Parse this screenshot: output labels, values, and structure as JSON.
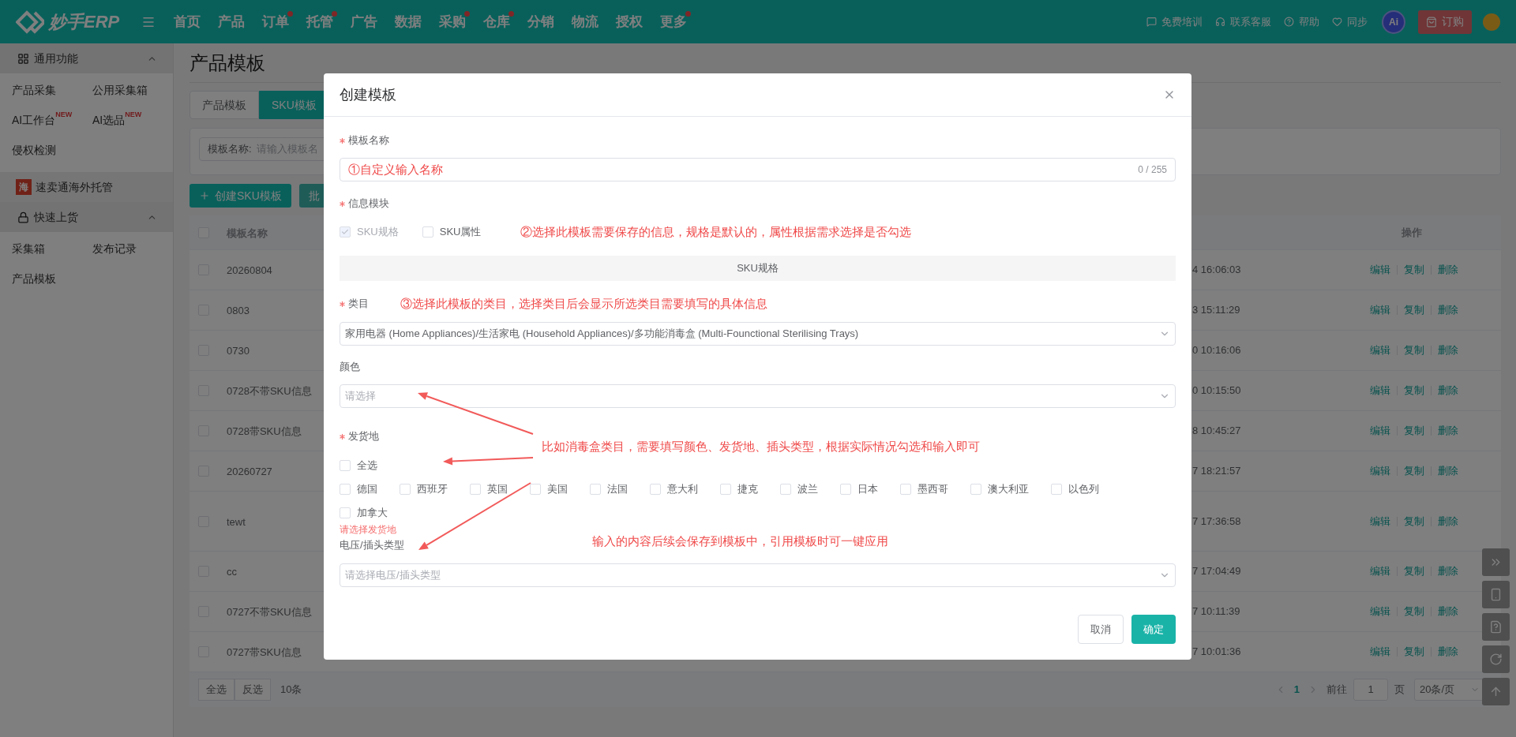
{
  "top_nav": {
    "logo": "妙手ERP",
    "items": [
      {
        "label": "首页",
        "badge": false
      },
      {
        "label": "产品",
        "badge": false
      },
      {
        "label": "订单",
        "badge": true
      },
      {
        "label": "托管",
        "badge": true
      },
      {
        "label": "广告",
        "badge": false
      },
      {
        "label": "数据",
        "badge": false
      },
      {
        "label": "采购",
        "badge": true
      },
      {
        "label": "仓库",
        "badge": true
      },
      {
        "label": "分销",
        "badge": false
      },
      {
        "label": "物流",
        "badge": false
      },
      {
        "label": "授权",
        "badge": false
      },
      {
        "label": "更多",
        "badge": true
      }
    ],
    "links": [
      {
        "label": "免费培训",
        "kind": "chat"
      },
      {
        "label": "联系客服",
        "kind": "service"
      },
      {
        "label": "帮助",
        "kind": "help"
      },
      {
        "label": "同步",
        "kind": "sync"
      }
    ],
    "ai_badge": "Ai",
    "order_button": "订购"
  },
  "sidebar": {
    "sections": [
      {
        "title": "通用功能",
        "kind": "grid",
        "expanded": true,
        "items": [
          {
            "label": "产品采集"
          },
          {
            "label": "公用采集箱"
          },
          {
            "label": "AI工作台",
            "tag": "NEW"
          },
          {
            "label": "AI选品",
            "tag": "NEW"
          },
          {
            "label": "侵权检测"
          }
        ]
      },
      {
        "title": "速卖通海外托管",
        "kind": "link",
        "icon_text": "海"
      },
      {
        "title": "快速上货",
        "kind": "lock",
        "expanded": true,
        "items": [
          {
            "label": "采集箱"
          },
          {
            "label": "发布记录"
          },
          {
            "label": "产品模板"
          }
        ]
      }
    ]
  },
  "page": {
    "title": "产品模板",
    "tabs": [
      {
        "label": "产品模板",
        "selected": false
      },
      {
        "label": "SKU模板",
        "selected": true
      }
    ],
    "filter": {
      "label": "模板名称:",
      "placeholder": "请输入模板名"
    },
    "actions": [
      {
        "label": "创建SKU模板",
        "kind": "primary"
      },
      {
        "label": "批",
        "kind": "disabled"
      }
    ],
    "table": {
      "all_checked": false,
      "columns": [
        "模板名称",
        "操作"
      ],
      "rows": [
        {
          "name": "20260804",
          "time": "4 16:06:03",
          "checked": false,
          "tall": false,
          "actions": [
            "编辑",
            "复制",
            "删除"
          ]
        },
        {
          "name": "0803",
          "time": "3 15:11:29",
          "checked": false,
          "tall": false,
          "actions": [
            "编辑",
            "复制",
            "删除"
          ]
        },
        {
          "name": "0730",
          "time": "0 10:16:06",
          "checked": false,
          "tall": false,
          "actions": [
            "编辑",
            "复制",
            "删除"
          ]
        },
        {
          "name": "0728不带SKU信息",
          "time": "0 10:15:50",
          "checked": false,
          "tall": false,
          "actions": [
            "编辑",
            "复制",
            "删除"
          ]
        },
        {
          "name": "0728带SKU信息",
          "time": "8 10:45:27",
          "checked": false,
          "tall": false,
          "actions": [
            "编辑",
            "复制",
            "删除"
          ]
        },
        {
          "name": "20260727",
          "time": "7 18:21:57",
          "checked": false,
          "tall": false,
          "actions": [
            "编辑",
            "复制",
            "删除"
          ]
        },
        {
          "name": "tewt",
          "time": "7 17:36:58",
          "checked": false,
          "tall": true,
          "actions": [
            "编辑",
            "复制",
            "删除"
          ]
        },
        {
          "name": "cc",
          "time": "7 17:04:49",
          "checked": false,
          "tall": false,
          "actions": [
            "编辑",
            "复制",
            "删除"
          ]
        },
        {
          "name": "0727不带SKU信息",
          "time": "7 10:11:39",
          "checked": false,
          "tall": false,
          "actions": [
            "编辑",
            "复制",
            "删除"
          ]
        },
        {
          "name": "0727带SKU信息",
          "time": "7 10:01:36",
          "checked": false,
          "tall": false,
          "actions": [
            "编辑",
            "复制",
            "删除"
          ]
        }
      ]
    },
    "footer": {
      "buttons": [
        "全选",
        "反选"
      ],
      "count": "10条",
      "current_page": "1",
      "goto_label": "前往",
      "goto_value": "1",
      "page_unit": "页",
      "page_size": "20条/页"
    }
  },
  "side_tools": [
    {
      "kind": "expand"
    },
    {
      "kind": "phone"
    },
    {
      "kind": "guide"
    },
    {
      "kind": "refresh"
    },
    {
      "kind": "top"
    }
  ],
  "modal": {
    "title": "创建模板",
    "name_field": {
      "label": "模板名称",
      "required": true,
      "value": "①自定义输入名称",
      "counter": "0 / 255"
    },
    "info_module": {
      "label": "信息模块",
      "required": true,
      "options": [
        {
          "label": "SKU规格",
          "checked": true,
          "disabled": true
        },
        {
          "label": "SKU属性",
          "checked": false
        }
      ],
      "note": "②选择此模板需要保存的信息，规格是默认的，属性根据需求选择是否勾选"
    },
    "section_title": "SKU规格",
    "category": {
      "label": "类目",
      "required": true,
      "note": "③选择此模板的类目，选择类目后会显示所选类目需要填写的具体信息",
      "value": "家用电器 (Home Appliances)/生活家电 (Household Appliances)/多功能消毒盒 (Multi-Founctional Sterilising Trays)"
    },
    "color": {
      "label": "颜色",
      "required": false,
      "placeholder": "请选择"
    },
    "ship_from": {
      "label": "发货地",
      "required": true,
      "select_all": {
        "label": "全选",
        "checked": false
      },
      "options": [
        {
          "label": "德国",
          "checked": false
        },
        {
          "label": "西班牙",
          "checked": false
        },
        {
          "label": "英国",
          "checked": false
        },
        {
          "label": "美国",
          "checked": false
        },
        {
          "label": "法国",
          "checked": false
        },
        {
          "label": "意大利",
          "checked": false
        },
        {
          "label": "捷克",
          "checked": false
        },
        {
          "label": "波兰",
          "checked": false
        },
        {
          "label": "日本",
          "checked": false
        },
        {
          "label": "墨西哥",
          "checked": false
        },
        {
          "label": "澳大利亚",
          "checked": false
        },
        {
          "label": "以色列",
          "checked": false
        },
        {
          "label": "加拿大",
          "checked": false
        }
      ],
      "error": "请选择发货地"
    },
    "plug_type": {
      "label": "电压/插头类型",
      "required": false,
      "placeholder": "请选择电压/插头类型"
    },
    "notes": [
      "比如消毒盒类目，需要填写颜色、发货地、插头类型，根据实际情况勾选和输入即可",
      "输入的内容后续会保存到模板中，引用模板时可一键应用"
    ],
    "buttons": [
      {
        "label": "取消",
        "kind": "secondary"
      },
      {
        "label": "确定",
        "kind": "primary"
      }
    ]
  }
}
